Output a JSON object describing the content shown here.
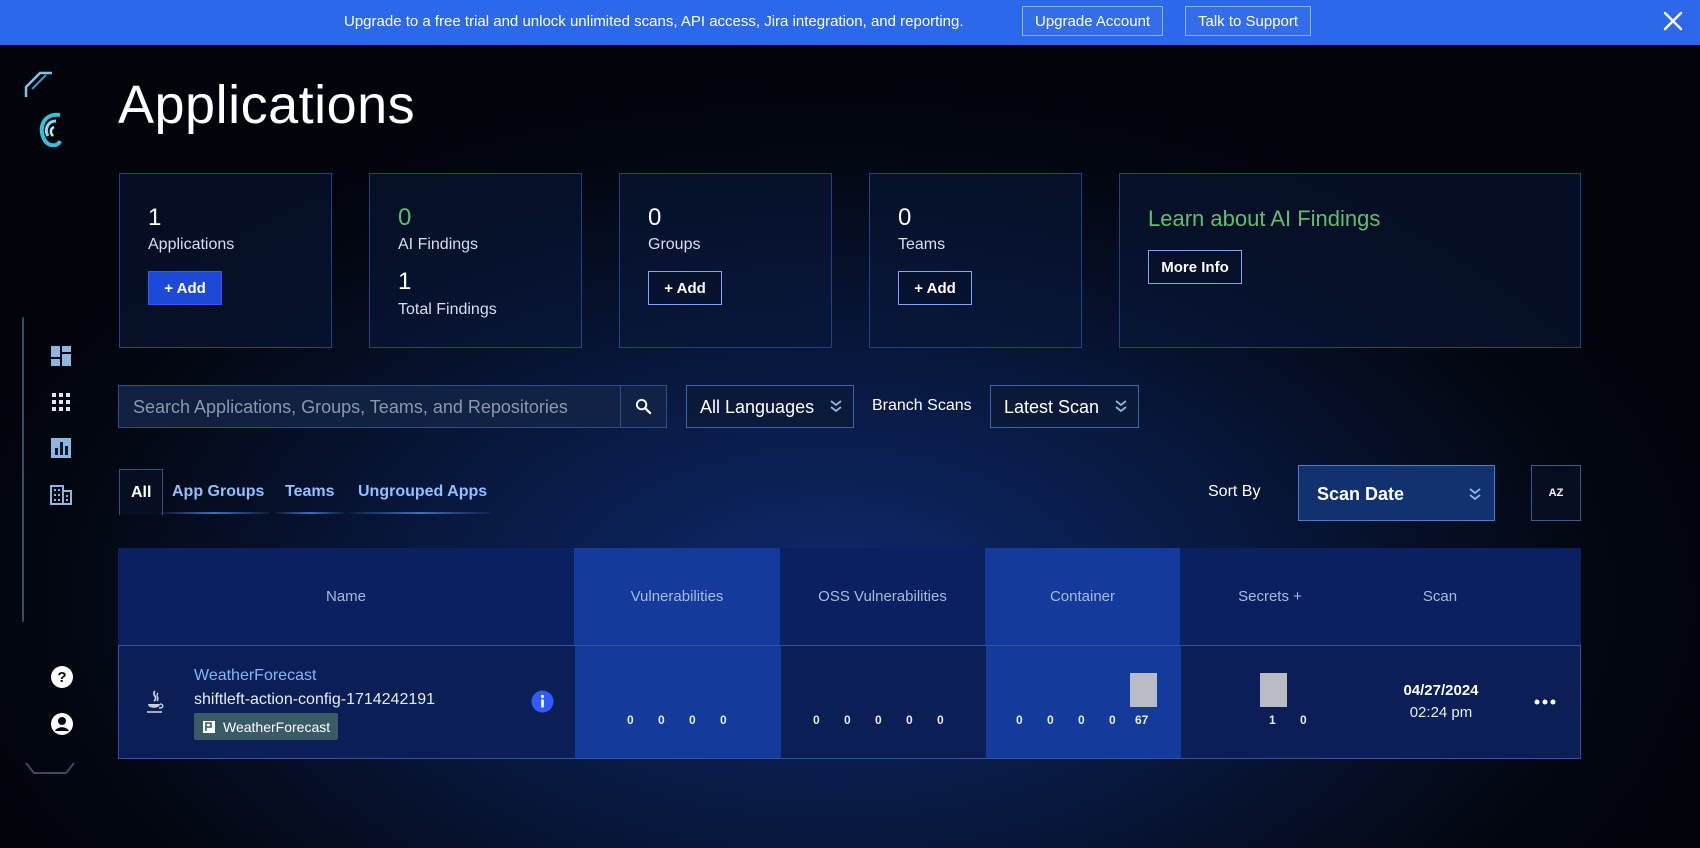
{
  "banner": {
    "message": "Upgrade to a free trial and unlock unlimited scans, API access, Jira integration, and reporting.",
    "upgrade_label": "Upgrade Account",
    "support_label": "Talk to Support"
  },
  "page": {
    "title": "Applications"
  },
  "cards": {
    "applications": {
      "count": "1",
      "label": "Applications",
      "add_label": "+ Add"
    },
    "ai_findings": {
      "count": "0",
      "label": "AI Findings",
      "total_count": "1",
      "total_label": "Total Findings"
    },
    "groups": {
      "count": "0",
      "label": "Groups",
      "add_label": "+ Add"
    },
    "teams": {
      "count": "0",
      "label": "Teams",
      "add_label": "+ Add"
    },
    "learn": {
      "title": "Learn about AI Findings",
      "button_label": "More Info"
    }
  },
  "filters": {
    "search_placeholder": "Search Applications, Groups, Teams, and Repositories",
    "languages_value": "All Languages",
    "branch_label": "Branch Scans",
    "branch_value": "Latest Scan"
  },
  "tabs": [
    "All",
    "App Groups",
    "Teams",
    "Ungrouped Apps"
  ],
  "sort": {
    "label": "Sort By",
    "value": "Scan Date",
    "order_label": "AZ"
  },
  "table": {
    "headers": [
      "Name",
      "Vulnerabilities",
      "OSS Vulnerabilities",
      "Container",
      "Secrets +",
      "Scan"
    ],
    "rows": [
      {
        "name": "WeatherForecast",
        "repo": "shiftleft-action-config-1714242191",
        "tag": "WeatherForecast",
        "vulnerabilities": [
          "0",
          "0",
          "0",
          "0"
        ],
        "oss_vulnerabilities": [
          "0",
          "0",
          "0",
          "0",
          "0"
        ],
        "container": [
          "0",
          "0",
          "0",
          "0",
          "67"
        ],
        "secrets": [
          "1",
          "0"
        ],
        "scan_date": "04/27/2024",
        "scan_time": "02:24 pm"
      }
    ]
  },
  "colors": {
    "banner": "#2b68ea",
    "accent_green": "#5ec06b",
    "link_blue": "#7fb6ff",
    "primary_button": "#1d49d8"
  }
}
